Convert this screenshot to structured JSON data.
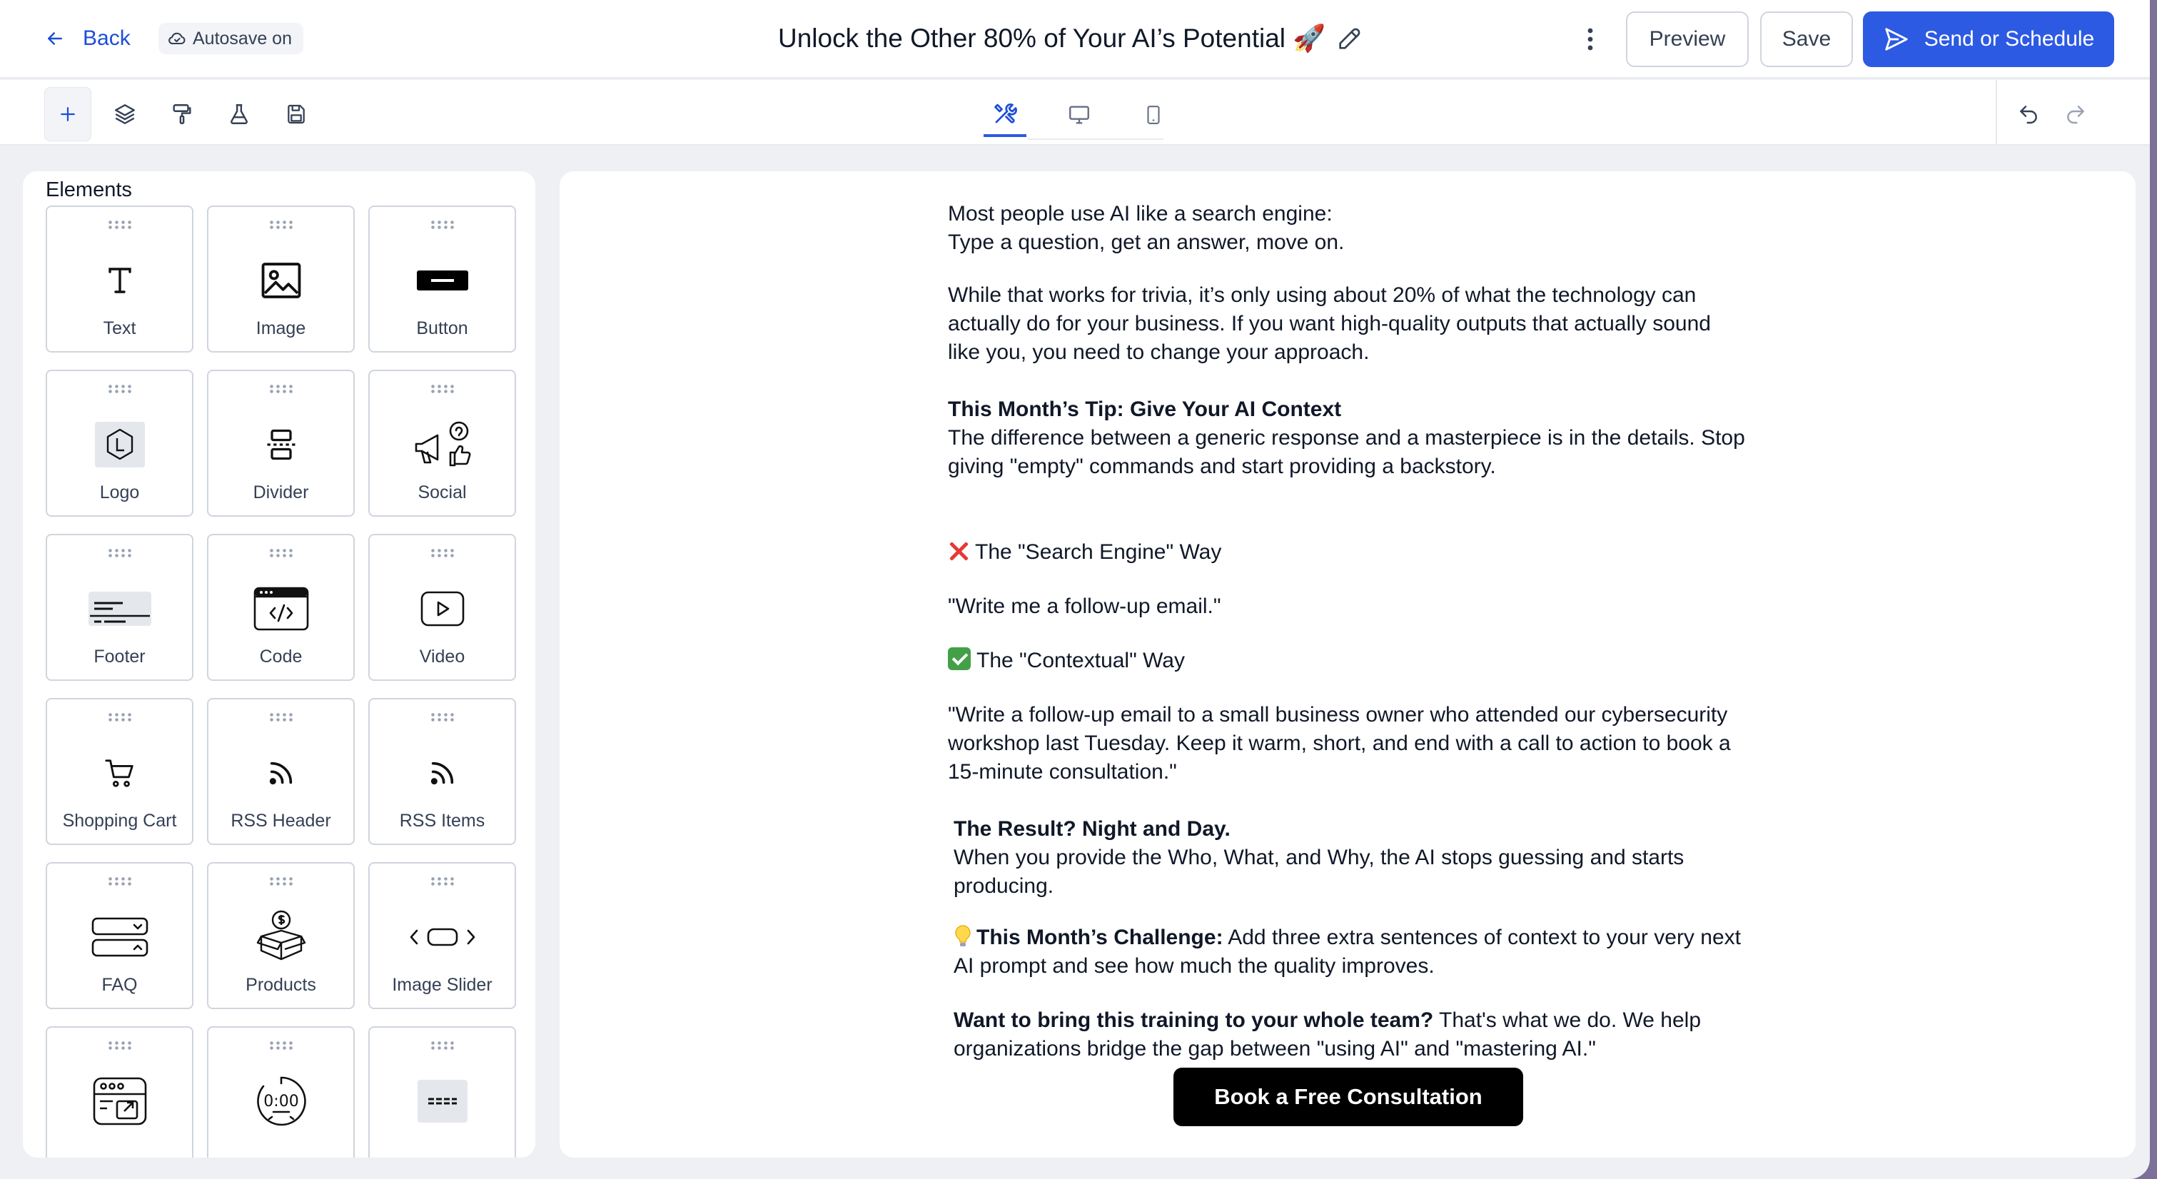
{
  "header": {
    "back_label": "Back",
    "autosave_label": "Autosave on",
    "title": "Unlock the Other 80% of Your AI’s Potential 🚀",
    "preview_label": "Preview",
    "save_label": "Save",
    "send_label": "Send or Schedule"
  },
  "toolbar": {
    "left_tools": [
      "add-icon",
      "layers-icon",
      "paint-roller-icon",
      "flask-icon",
      "save-icon"
    ],
    "view_tabs": [
      "design-tools-icon",
      "desktop-icon",
      "mobile-icon"
    ],
    "right_tools": [
      "undo-icon",
      "redo-icon"
    ]
  },
  "elements_panel": {
    "title": "Elements",
    "items": [
      {
        "label": "Text",
        "icon": "text-icon"
      },
      {
        "label": "Image",
        "icon": "image-icon"
      },
      {
        "label": "Button",
        "icon": "button-icon"
      },
      {
        "label": "Logo",
        "icon": "logo-icon"
      },
      {
        "label": "Divider",
        "icon": "divider-icon"
      },
      {
        "label": "Social",
        "icon": "social-icon"
      },
      {
        "label": "Footer",
        "icon": "footer-icon"
      },
      {
        "label": "Code",
        "icon": "code-icon"
      },
      {
        "label": "Video",
        "icon": "video-icon"
      },
      {
        "label": "Shopping Cart",
        "icon": "shopping-cart-icon"
      },
      {
        "label": "RSS Header",
        "icon": "rss-icon"
      },
      {
        "label": "RSS Items",
        "icon": "rss-icon"
      },
      {
        "label": "FAQ",
        "icon": "faq-icon"
      },
      {
        "label": "Products",
        "icon": "products-icon"
      },
      {
        "label": "Image Slider",
        "icon": "image-slider-icon"
      },
      {
        "label": "",
        "icon": "browser-link-icon"
      },
      {
        "label": "",
        "icon": "countdown-timer-icon"
      },
      {
        "label": "",
        "icon": "spacer-icon"
      }
    ]
  },
  "email": {
    "p1_line1": "Most people use AI like a search engine:",
    "p1_line2": "Type a question, get an answer, move on.",
    "p2": "While that works for trivia, it’s only using about 20% of what the technology can actually do for your business. If you want high-quality outputs that actually sound like you, you need to change your approach.",
    "tip_heading": "This Month’s Tip: Give Your AI Context",
    "tip_body": "The difference between a generic response and a masterpiece is in the details. Stop giving \"empty\" commands and start providing a backstory.",
    "search_way": "The \"Search Engine\" Way",
    "search_example": "\"Write me a follow-up email.\"",
    "contextual_way": "The \"Contextual\" Way",
    "contextual_example": "\"Write a follow-up email to a small business owner who attended our cybersecurity workshop last Tuesday. Keep it warm, short, and end with a call to action to book a 15-minute consultation.\"",
    "result_heading": "The Result? Night and Day.",
    "result_body": "When you provide the Who, What, and Why, the AI stops guessing and starts producing.",
    "challenge_heading": "This Month’s Challenge:",
    "challenge_body": " Add three extra sentences of context to your very next AI prompt and see how much the quality improves.",
    "team_heading": "Want to bring this training to your whole team?",
    "team_body": " That's what we do. We help organizations bridge the gap between \"using AI\" and \"mastering AI.\"",
    "cta_label": "Book a Free Consultation"
  }
}
